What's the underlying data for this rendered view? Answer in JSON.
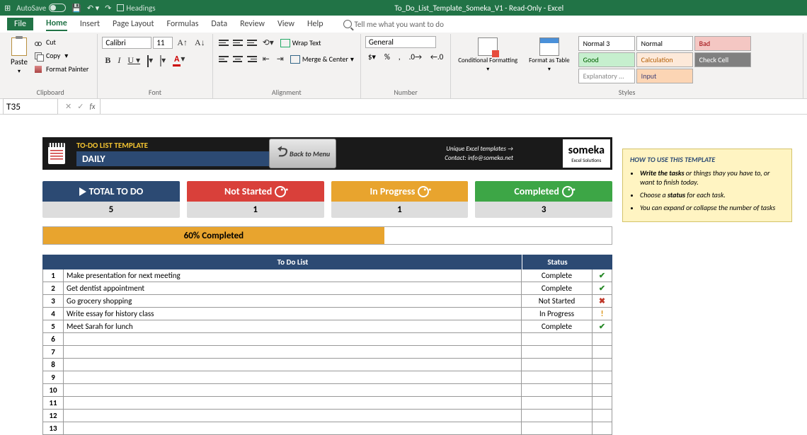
{
  "titlebar": {
    "autosave": "AutoSave",
    "headings": "Headings",
    "title": "To_Do_List_Template_Someka_V1 - Read-Only - Excel"
  },
  "menu": {
    "file": "File",
    "tabs": [
      "Home",
      "Insert",
      "Page Layout",
      "Formulas",
      "Data",
      "Review",
      "View",
      "Help"
    ],
    "active": "Home",
    "tellme": "Tell me what you want to do"
  },
  "ribbon": {
    "clipboard": {
      "paste": "Paste",
      "cut": "Cut",
      "copy": "Copy",
      "painter": "Format Painter",
      "label": "Clipboard"
    },
    "font": {
      "name": "Calibri",
      "size": "11",
      "label": "Font"
    },
    "alignment": {
      "wrap": "Wrap Text",
      "merge": "Merge & Center",
      "label": "Alignment"
    },
    "number": {
      "format": "General",
      "label": "Number"
    },
    "styles": {
      "cond": "Conditional Formatting",
      "table": "Format as Table",
      "cells": [
        {
          "text": "Normal 3",
          "bg": "#ffffff",
          "color": "#000"
        },
        {
          "text": "Normal",
          "bg": "#ffffff",
          "color": "#000"
        },
        {
          "text": "Bad",
          "bg": "#f4c7c3",
          "color": "#9c0006"
        },
        {
          "text": "Good",
          "bg": "#c6efce",
          "color": "#006100"
        },
        {
          "text": "Calculation",
          "bg": "#fde9d9",
          "color": "#b45f06"
        },
        {
          "text": "Check Cell",
          "bg": "#808080",
          "color": "#fff"
        },
        {
          "text": "Explanatory ...",
          "bg": "#ffffff",
          "color": "#888"
        },
        {
          "text": "Input",
          "bg": "#fcd5b4",
          "color": "#3f3f76"
        }
      ],
      "label": "Styles"
    }
  },
  "namebox": "T35",
  "template": {
    "title": "TO-DO LIST TEMPLATE",
    "subtitle": "DAILY",
    "backbtn": "Back to Menu",
    "tagline": "Unique Excel templates →",
    "contact": "Contact: info@someka.net",
    "brand": "someka",
    "brand_sub": "Excel Solutions"
  },
  "cards": {
    "total": {
      "label": "TOTAL TO DO",
      "value": "5"
    },
    "notstarted": {
      "label": "Not Started",
      "value": "1"
    },
    "inprogress": {
      "label": "In Progress",
      "value": "1"
    },
    "completed": {
      "label": "Completed",
      "value": "3"
    }
  },
  "progress": {
    "text": "60% Completed",
    "pct": 60
  },
  "table": {
    "hdr_task": "To Do List",
    "hdr_status": "Status",
    "rows": [
      {
        "n": "1",
        "task": "Make presentation for next meeting",
        "status": "Complete",
        "icon": "check"
      },
      {
        "n": "2",
        "task": "Get dentist appointment",
        "status": "Complete",
        "icon": "check"
      },
      {
        "n": "3",
        "task": "Go grocery shopping",
        "status": "Not Started",
        "icon": "cross"
      },
      {
        "n": "4",
        "task": "Write essay for history class",
        "status": "In Progress",
        "icon": "warn"
      },
      {
        "n": "5",
        "task": "Meet Sarah for lunch",
        "status": "Complete",
        "icon": "check"
      },
      {
        "n": "6",
        "task": "",
        "status": "",
        "icon": ""
      },
      {
        "n": "7",
        "task": "",
        "status": "",
        "icon": ""
      },
      {
        "n": "8",
        "task": "",
        "status": "",
        "icon": ""
      },
      {
        "n": "9",
        "task": "",
        "status": "",
        "icon": ""
      },
      {
        "n": "10",
        "task": "",
        "status": "",
        "icon": ""
      },
      {
        "n": "11",
        "task": "",
        "status": "",
        "icon": ""
      },
      {
        "n": "12",
        "task": "",
        "status": "",
        "icon": ""
      },
      {
        "n": "13",
        "task": "",
        "status": "",
        "icon": ""
      }
    ]
  },
  "help": {
    "title": "HOW TO USE THIS TEMPLATE",
    "items": [
      "<b>Write the tasks</b> or things thay you have to, or want to finish today.",
      "Choose a <b>status</b> for each task.",
      "You can expand or collapse the number of tasks"
    ]
  }
}
